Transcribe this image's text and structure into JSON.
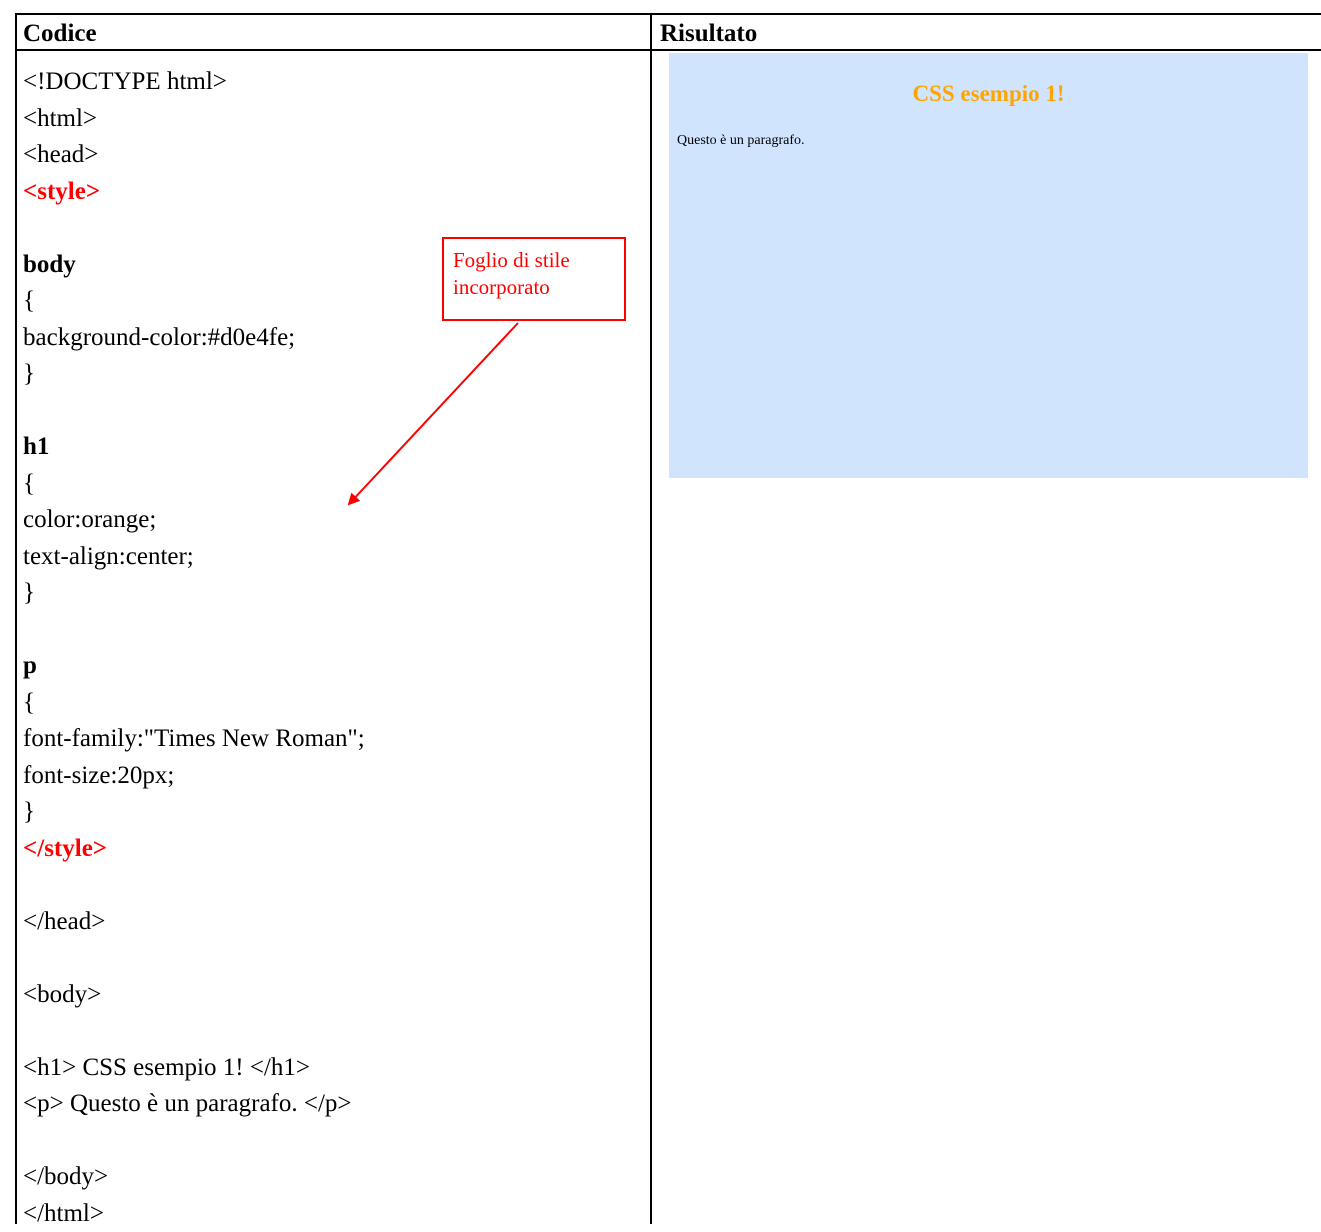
{
  "table": {
    "code_header": "Codice",
    "result_header": "Risultato"
  },
  "code": {
    "l1": "<!DOCTYPE html>",
    "l2": "<html>",
    "l3": "<head>",
    "l4": "<style>",
    "l5": "body",
    "l6": "{",
    "l7": "background-color:#d0e4fe;",
    "l8": "}",
    "l9": "h1",
    "l10": "{",
    "l11": "color:orange;",
    "l12": "text-align:center;",
    "l13": "}",
    "l14": "p",
    "l15": "{",
    "l16": "font-family:\"Times New Roman\";",
    "l17": "font-size:20px;",
    "l18": "}",
    "l19": "</style>",
    "l20": "</head>",
    "l21": "<body>",
    "l22": "<h1> CSS esempio 1! </h1>",
    "l23": "<p> Questo è un paragrafo. </p>",
    "l24": "</body>",
    "l25": "</html>"
  },
  "callout": {
    "line1": "Foglio di stile",
    "line2": "incorporato"
  },
  "preview": {
    "background": "#d0e4fe",
    "heading": "CSS esempio 1!",
    "heading_color": "orange",
    "paragraph": "Questo è un paragrafo."
  },
  "colors": {
    "annotation": "#ff0000"
  }
}
